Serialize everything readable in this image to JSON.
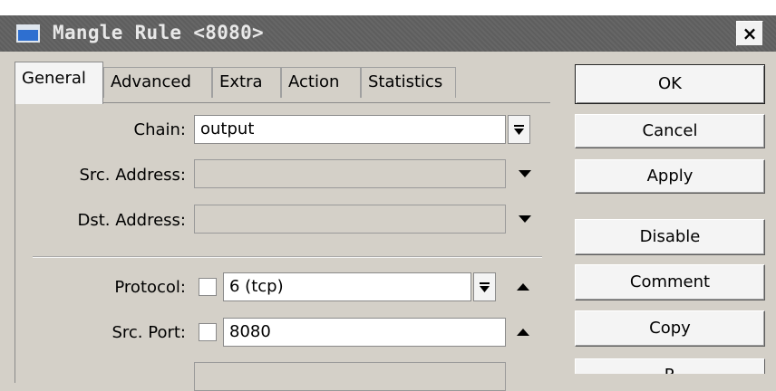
{
  "window": {
    "title": "Mangle Rule <8080>",
    "close_label": "×",
    "icon": "window-icon"
  },
  "tabs": [
    {
      "label": "General",
      "active": true
    },
    {
      "label": "Advanced",
      "active": false
    },
    {
      "label": "Extra",
      "active": false
    },
    {
      "label": "Action",
      "active": false
    },
    {
      "label": "Statistics",
      "active": false
    }
  ],
  "form": {
    "chain": {
      "label": "Chain:",
      "value": "output",
      "dropdown_icon": "combo-dropdown-icon"
    },
    "src_address": {
      "label": "Src. Address:",
      "value": "",
      "dropdown_icon": "expand-down-icon"
    },
    "dst_address": {
      "label": "Dst. Address:",
      "value": "",
      "dropdown_icon": "expand-down-icon"
    },
    "protocol": {
      "label": "Protocol:",
      "value": "6 (tcp)",
      "negate_checked": false,
      "dropdown_icon": "combo-dropdown-icon",
      "collapse_icon": "collapse-up-icon"
    },
    "src_port": {
      "label": "Src. Port:",
      "value": "8080",
      "negate_checked": false,
      "collapse_icon": "collapse-up-icon"
    },
    "dst_port": {
      "label": "",
      "value": ""
    }
  },
  "buttons": {
    "ok": "OK",
    "cancel": "Cancel",
    "apply": "Apply",
    "disable": "Disable",
    "comment": "Comment",
    "copy": "Copy",
    "remove": "R"
  },
  "colors": {
    "titlebar": "#616161",
    "dialog_bg": "#d4d0c8",
    "field_bg": "#ffffff",
    "button_bg": "#f4f4f4",
    "icon_blue": "#2e6fd0"
  }
}
